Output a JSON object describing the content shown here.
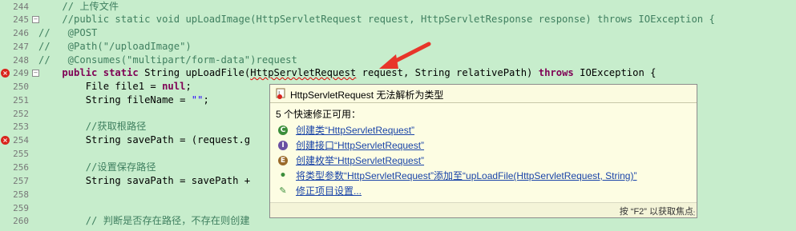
{
  "editor": {
    "lines": [
      {
        "num": "244",
        "segments": [
          {
            "t": "    ",
            "c": ""
          },
          {
            "t": "// 上传文件",
            "c": "cm"
          }
        ]
      },
      {
        "num": "245",
        "segments": [
          {
            "t": "    ",
            "c": ""
          },
          {
            "t": "//public static void upLoadImage(HttpServletRequest request, HttpServletResponse response) throws IOException {",
            "c": "cm"
          }
        ]
      },
      {
        "num": "246",
        "segments": [
          {
            "t": "//   @POST",
            "c": "cm"
          }
        ]
      },
      {
        "num": "247",
        "segments": [
          {
            "t": "//   @Path(\"/uploadImage\")",
            "c": "cm"
          }
        ]
      },
      {
        "num": "248",
        "segments": [
          {
            "t": "//   @Consumes(\"multipart/form-data\")request",
            "c": "cm"
          }
        ]
      },
      {
        "num": "249",
        "segments": [
          {
            "t": "    ",
            "c": ""
          },
          {
            "t": "public",
            "c": "kw"
          },
          {
            "t": " ",
            "c": ""
          },
          {
            "t": "static",
            "c": "kw"
          },
          {
            "t": " String upLoadFile(",
            "c": ""
          },
          {
            "t": "HttpServletRequest",
            "c": "err"
          },
          {
            "t": " request, String relativePath) ",
            "c": ""
          },
          {
            "t": "throws",
            "c": "kw"
          },
          {
            "t": " IOException {",
            "c": ""
          }
        ]
      },
      {
        "num": "250",
        "segments": [
          {
            "t": "        File file1 = ",
            "c": ""
          },
          {
            "t": "null",
            "c": "kw"
          },
          {
            "t": ";",
            "c": ""
          }
        ]
      },
      {
        "num": "251",
        "segments": [
          {
            "t": "        String fileName = ",
            "c": ""
          },
          {
            "t": "\"\"",
            "c": "str"
          },
          {
            "t": ";",
            "c": ""
          }
        ]
      },
      {
        "num": "252",
        "segments": [
          {
            "t": "",
            "c": ""
          }
        ]
      },
      {
        "num": "253",
        "segments": [
          {
            "t": "        ",
            "c": ""
          },
          {
            "t": "//获取根路径",
            "c": "cm"
          }
        ]
      },
      {
        "num": "254",
        "segments": [
          {
            "t": "        String savePath = (request.g",
            "c": ""
          }
        ]
      },
      {
        "num": "255",
        "segments": [
          {
            "t": "",
            "c": ""
          }
        ]
      },
      {
        "num": "256",
        "segments": [
          {
            "t": "        ",
            "c": ""
          },
          {
            "t": "//设置保存路径",
            "c": "cm"
          }
        ]
      },
      {
        "num": "257",
        "segments": [
          {
            "t": "        String savaPath = savePath +",
            "c": ""
          }
        ]
      },
      {
        "num": "258",
        "segments": [
          {
            "t": "",
            "c": ""
          }
        ]
      },
      {
        "num": "259",
        "segments": [
          {
            "t": "",
            "c": ""
          }
        ]
      },
      {
        "num": "260",
        "segments": [
          {
            "t": "        ",
            "c": ""
          },
          {
            "t": "// 判断是否存在路径，不存在则创建",
            "c": "cm"
          }
        ]
      }
    ]
  },
  "popup": {
    "title": "HttpServletRequest 无法解析为类型",
    "count_text": "5 个快速修正可用：",
    "fixes": [
      {
        "label": "创建类“HttpServletRequest”",
        "icon": "class-icon",
        "color": "#3b8e3b",
        "glyph": "C"
      },
      {
        "label": "创建接口“HttpServletRequest”",
        "icon": "interface-icon",
        "color": "#6a4fa3",
        "glyph": "I"
      },
      {
        "label": "创建枚举“HttpServletRequest”",
        "icon": "enum-icon",
        "color": "#9a6a2a",
        "glyph": "E"
      },
      {
        "label": "将类型参数“HttpServletRequest”添加至“upLoadFile(HttpServletRequest, String)”",
        "icon": "type-parameter-icon",
        "color": "#3b8e3b",
        "glyph": "•"
      },
      {
        "label": "修正项目设置...",
        "icon": "project-settings-icon",
        "color": "#3b8e3b",
        "glyph": "✎"
      }
    ],
    "footer_hint": "按 “F2” 以获取焦点"
  },
  "colors": {
    "error": "#d9241c",
    "keyword": "#7f0055",
    "comment": "#3f7f5f",
    "string": "#2a00ff",
    "link": "#1a44a8",
    "arrow": "#e8352a"
  }
}
